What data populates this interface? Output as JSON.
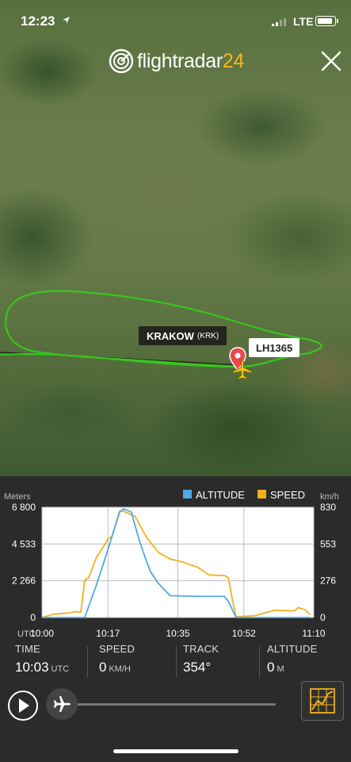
{
  "status_bar": {
    "time": "12:23",
    "network": "LTE"
  },
  "brand": {
    "name": "flightradar",
    "number": "24"
  },
  "map": {
    "airport_name": "KRAKOW",
    "airport_code": "(KRK)",
    "flight_label": "LH1365"
  },
  "colors": {
    "route": "#35c61d",
    "altitude": "#4fa8e8",
    "speed": "#f2b01e",
    "brand_accent": "#f5b81d"
  },
  "chart": {
    "left_unit": "Meters",
    "right_unit": "km/h",
    "left_ticks": [
      "6 800",
      "4 533",
      "2 266",
      "0"
    ],
    "right_ticks": [
      "830",
      "553",
      "276",
      "0"
    ],
    "x_prefix": "UTC",
    "x_ticks": [
      "10:00",
      "10:17",
      "10:35",
      "10:52",
      "11:10"
    ],
    "legend_altitude": "ALTITUDE",
    "legend_speed": "SPEED"
  },
  "chart_data": {
    "type": "line",
    "x_unit": "UTC minutes",
    "xlim": [
      "10:00",
      "11:10"
    ],
    "ylim_left": [
      0,
      6800
    ],
    "ylim_right": [
      0,
      830
    ],
    "series": [
      {
        "name": "ALTITUDE",
        "axis": "left",
        "x": [
          "10:00",
          "10:10",
          "10:11",
          "10:14",
          "10:17",
          "10:20",
          "10:21",
          "10:23",
          "10:25",
          "10:27",
          "10:28",
          "10:30",
          "10:33",
          "10:40",
          "10:47",
          "10:48",
          "10:50",
          "10:55",
          "11:00",
          "11:05",
          "11:09"
        ],
        "y": [
          0,
          0,
          0,
          2000,
          4200,
          6500,
          6700,
          6500,
          4800,
          3400,
          2800,
          2100,
          1350,
          1300,
          1300,
          1000,
          0,
          0,
          0,
          0,
          0
        ]
      },
      {
        "name": "SPEED",
        "axis": "right",
        "x": [
          "10:00",
          "10:03",
          "10:07",
          "10:09",
          "10:10",
          "10:11",
          "10:12",
          "10:14",
          "10:17",
          "10:18",
          "10:20",
          "10:21",
          "10:24",
          "10:27",
          "10:30",
          "10:33",
          "10:36",
          "10:40",
          "10:43",
          "10:47",
          "10:48",
          "10:49",
          "10:50",
          "10:55",
          "10:58",
          "11:00",
          "11:05",
          "11:06",
          "11:08",
          "11:09"
        ],
        "y": [
          0,
          25,
          35,
          45,
          40,
          280,
          300,
          450,
          590,
          610,
          800,
          800,
          760,
          600,
          490,
          440,
          420,
          380,
          320,
          315,
          300,
          140,
          5,
          15,
          40,
          55,
          50,
          75,
          55,
          20
        ]
      }
    ]
  },
  "stats": {
    "time_label": "TIME",
    "time_value": "10:03",
    "time_unit": "UTC",
    "speed_label": "SPEED",
    "speed_value": "0",
    "speed_unit": "KM/H",
    "track_label": "TRACK",
    "track_value": "354°",
    "altitude_label": "ALTITUDE",
    "altitude_value": "0",
    "altitude_unit": "M"
  },
  "playback": {
    "progress": 0.04
  }
}
